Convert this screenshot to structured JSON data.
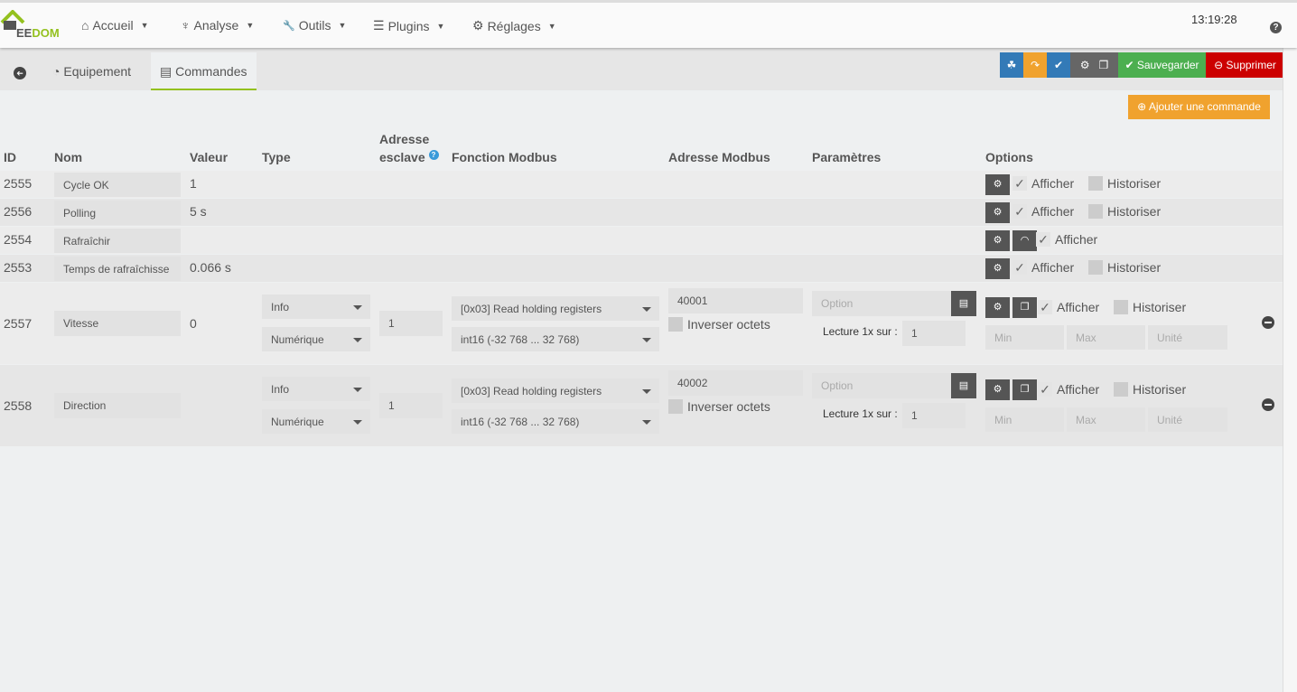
{
  "nav": {
    "logo": "JEEDOM",
    "items": [
      {
        "icon": "home-icon",
        "glyph": "⌂",
        "label": "Accueil"
      },
      {
        "icon": "stethoscope-icon",
        "glyph": "♆",
        "label": "Analyse"
      },
      {
        "icon": "wrench-icon",
        "glyph": "🔧",
        "label": "Outils"
      },
      {
        "icon": "list-icon",
        "glyph": "☰",
        "label": "Plugins"
      },
      {
        "icon": "gear-icon",
        "glyph": "⚙",
        "label": "Réglages"
      }
    ],
    "clock": "13:19:28",
    "help": "?"
  },
  "tabs": {
    "back": "➔",
    "equipement": "Equipement",
    "commandes": "Commandes"
  },
  "actions": {
    "save": "Sauvegarder",
    "delete": "Supprimer",
    "add_command": "Ajouter une commande"
  },
  "columns": {
    "id": "ID",
    "nom": "Nom",
    "valeur": "Valeur",
    "type": "Type",
    "adresse_esclave_1": "Adresse",
    "adresse_esclave_2": "esclave",
    "fonction": "Fonction Modbus",
    "adresse_modbus": "Adresse Modbus",
    "parametres": "Paramètres",
    "options": "Options"
  },
  "labels": {
    "afficher": "Afficher",
    "historiser": "Historiser",
    "inverser": "Inverser octets",
    "lecture": "Lecture 1x sur :",
    "option_ph": "Option",
    "min_ph": "Min",
    "max_ph": "Max",
    "unite_ph": "Unité"
  },
  "simple_rows": [
    {
      "id": "2555",
      "name": "Cycle OK",
      "value": "1",
      "historiser": true
    },
    {
      "id": "2556",
      "name": "Polling",
      "value": "5 s",
      "historiser": true
    },
    {
      "id": "2554",
      "name": "Rafraîchir",
      "value": "",
      "historiser": false
    },
    {
      "id": "2553",
      "name": "Temps de rafraîchisse",
      "value": "0.066 s",
      "historiser": true
    }
  ],
  "modbus_rows": [
    {
      "id": "2557",
      "name": "Vitesse",
      "value": "0",
      "type": "Info",
      "subtype": "Numérique",
      "slave": "1",
      "function": "[0x03] Read holding registers",
      "format": "int16 (-32 768 ... 32 768)",
      "address": "40001",
      "lecture": "1"
    },
    {
      "id": "2558",
      "name": "Direction",
      "value": "",
      "type": "Info",
      "subtype": "Numérique",
      "slave": "1",
      "function": "[0x03] Read holding registers",
      "format": "int16 (-32 768 ... 32 768)",
      "address": "40002",
      "lecture": "1"
    }
  ]
}
